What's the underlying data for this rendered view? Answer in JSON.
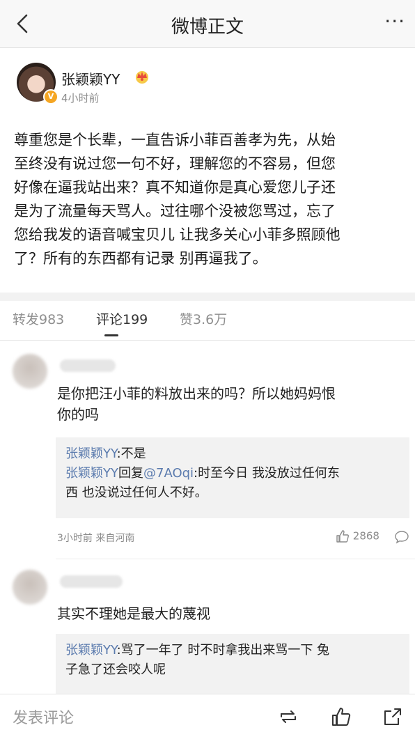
{
  "nav": {
    "title": "微博正文",
    "more": "···"
  },
  "post": {
    "author": "张颖颖YY",
    "time": "4小时前",
    "lines": [
      "尊重您是个长辈，一直告诉小菲百善孝为先，从始",
      "至终没有说过您一句不好，理解您的不容易，但您",
      "好像在逼我站出来？真不知道你是真心爱您儿子还",
      "是为了流量每天骂人。过往哪个没被您骂过，忘了",
      "您给我发的语音喊宝贝儿 让我多关心小菲多照顾他",
      "了？所有的东西都有记录 别再逼我了。"
    ]
  },
  "tabs": {
    "repost": "转发983",
    "comments": "评论199",
    "likes": "赞3.6万"
  },
  "comments": [
    {
      "text_lines": [
        "是你把汪小菲的料放出来的吗？所以她妈妈恨",
        "你的吗"
      ],
      "replies": [
        {
          "name": "张颖颖YY",
          "text": ":不是"
        },
        {
          "name": "张颖颖YY",
          "mid": "回复",
          "at": "@7AOqi",
          "text": ":时至今日 我没放过任何东",
          "text2": "西 也没说过任何人不好。"
        }
      ],
      "meta": "3小时前 来自河南",
      "likes": "2868"
    },
    {
      "text_lines": [
        "其实不理她是最大的蔑视"
      ],
      "replies": [
        {
          "name": "张颖颖YY",
          "text": ":骂了一年了 时不时拿我出来骂一下 兔",
          "text2": "子急了还会咬人呢"
        }
      ]
    }
  ],
  "bottom": {
    "placeholder": "发表评论"
  },
  "colors": {
    "link": "#5b7bae",
    "badge": "#f5a623"
  }
}
